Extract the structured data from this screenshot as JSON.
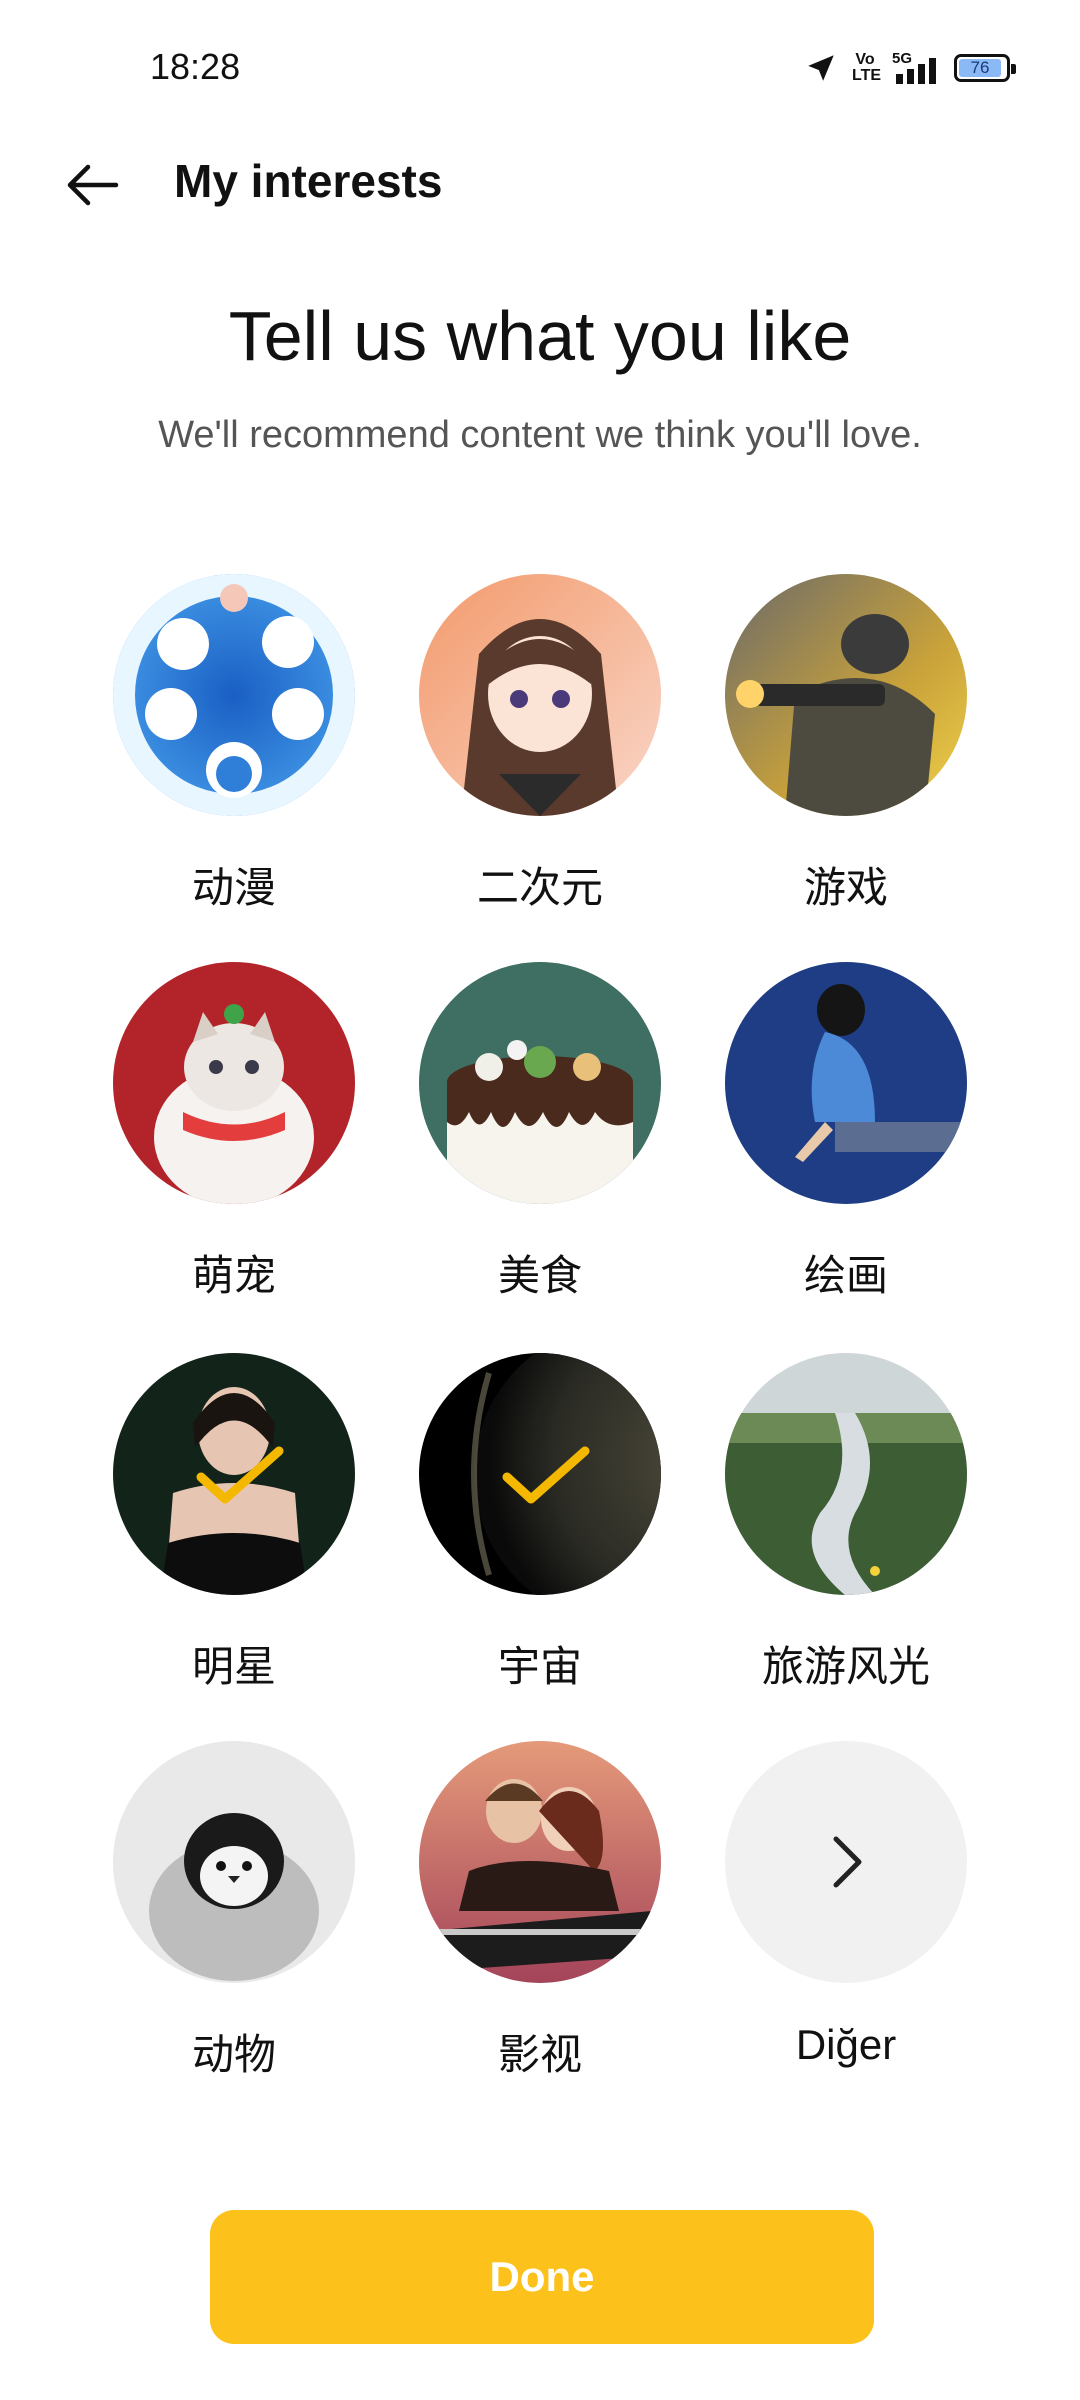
{
  "status_bar": {
    "time": "18:28",
    "volte": "Vo LTE",
    "network": "5G",
    "battery": "76"
  },
  "header": {
    "title": "My interests",
    "back_icon": "arrow-left-icon"
  },
  "intro": {
    "headline": "Tell us what you like",
    "subline": "We'll recommend content we think you'll love."
  },
  "interests": [
    {
      "label": "动漫",
      "selected": false
    },
    {
      "label": "二次元",
      "selected": false
    },
    {
      "label": "游戏",
      "selected": false
    },
    {
      "label": "萌宠",
      "selected": false
    },
    {
      "label": "美食",
      "selected": false
    },
    {
      "label": "绘画",
      "selected": false
    },
    {
      "label": "明星",
      "selected": true
    },
    {
      "label": "宇宙",
      "selected": true
    },
    {
      "label": "旅游风光",
      "selected": false
    },
    {
      "label": "动物",
      "selected": false
    },
    {
      "label": "影视",
      "selected": false
    },
    {
      "label": "Diğer",
      "selected": false,
      "icon": "chevron-right-icon"
    }
  ],
  "done_button": {
    "label": "Done"
  },
  "colors": {
    "accent": "#fcc21b",
    "check": "#f5b800",
    "more_bg": "#f1f1f1"
  }
}
